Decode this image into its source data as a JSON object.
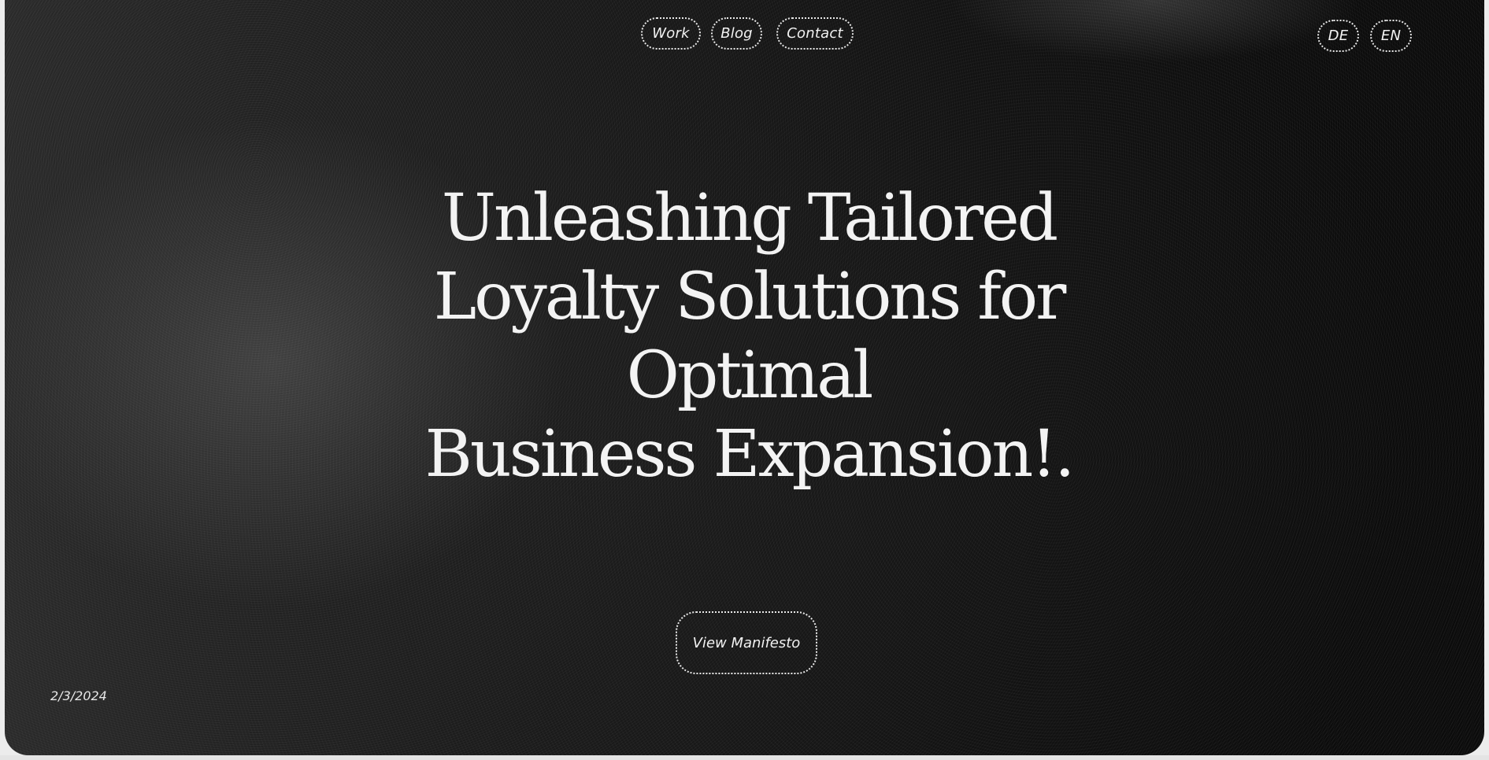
{
  "nav": {
    "items": [
      {
        "label": "Work"
      },
      {
        "label": "Blog"
      },
      {
        "label": "Contact"
      }
    ]
  },
  "language": {
    "options": [
      {
        "label": "DE"
      },
      {
        "label": "EN"
      }
    ]
  },
  "hero": {
    "headline_lines": [
      "Unleashing Tailored",
      "Loyalty Solutions for",
      "Optimal",
      "Business Expansion!."
    ],
    "cta_label": "View Manifesto"
  },
  "footer": {
    "date": "2/3/2024"
  },
  "colors": {
    "background": "#0f0f0f",
    "text": "#f3f3f3",
    "border": "#e8e8e8"
  }
}
